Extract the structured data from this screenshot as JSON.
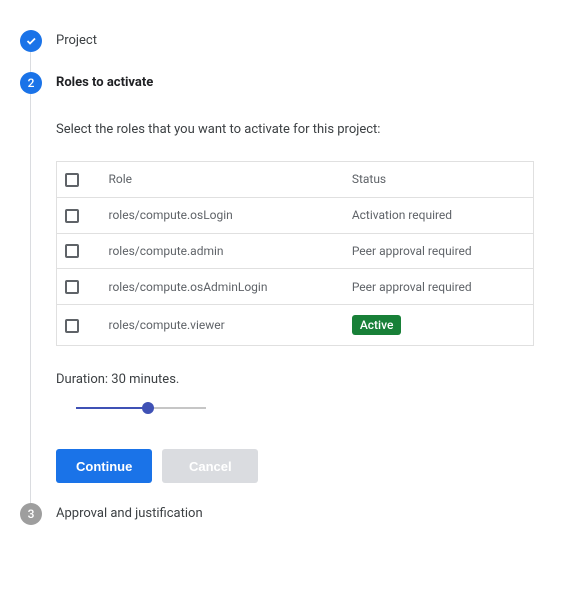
{
  "steps": {
    "project": {
      "label": "Project",
      "number": ""
    },
    "roles": {
      "label": "Roles to activate",
      "number": "2"
    },
    "approval": {
      "label": "Approval and justification",
      "number": "3"
    }
  },
  "instruction": "Select the roles that you want to activate for this project:",
  "table": {
    "headers": {
      "role": "Role",
      "status": "Status"
    },
    "rows": [
      {
        "role": "roles/compute.osLogin",
        "status": "Activation required",
        "badge": false
      },
      {
        "role": "roles/compute.admin",
        "status": "Peer approval required",
        "badge": false
      },
      {
        "role": "roles/compute.osAdminLogin",
        "status": "Peer approval required",
        "badge": false
      },
      {
        "role": "roles/compute.viewer",
        "status": "Active",
        "badge": true
      }
    ]
  },
  "duration": {
    "label": "Duration: 30 minutes.",
    "percent": 55
  },
  "buttons": {
    "continue": "Continue",
    "cancel": "Cancel"
  }
}
